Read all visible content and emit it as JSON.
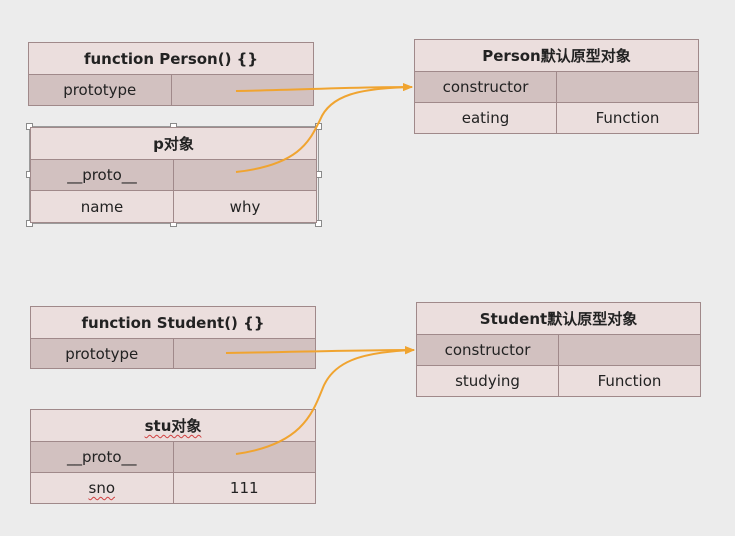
{
  "person_fn": {
    "title": "function Person() {}",
    "row1": "prototype"
  },
  "person_proto": {
    "title": "Person默认原型对象",
    "row1": "constructor",
    "row2_key": "eating",
    "row2_val": "Function"
  },
  "p_obj": {
    "title": "p对象",
    "row1": "__proto__",
    "row2_key": "name",
    "row2_val": "why"
  },
  "student_fn": {
    "title": "function Student() {}",
    "row1": "prototype"
  },
  "student_proto": {
    "title": "Student默认原型对象",
    "row1": "constructor",
    "row2_key": "studying",
    "row2_val": "Function"
  },
  "stu_obj": {
    "title": "stu对象",
    "row1": "__proto__",
    "row2_key": "sno",
    "row2_val": "111"
  },
  "colors": {
    "arrow": "#f0a430",
    "header": "#ebdedd",
    "dark_row": "#d2c1c0",
    "border": "#a0898a"
  }
}
